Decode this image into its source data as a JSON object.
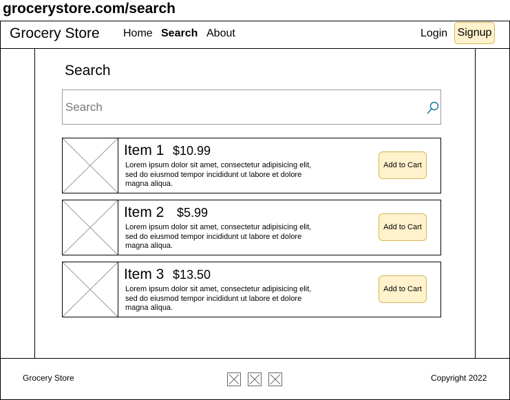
{
  "url_bar": {
    "url": "grocerystore.com/search"
  },
  "header": {
    "brand": "Grocery Store",
    "nav": [
      {
        "label": "Home",
        "active": false
      },
      {
        "label": "Search",
        "active": true
      },
      {
        "label": "About",
        "active": false
      }
    ],
    "login_label": "Login",
    "signup_label": "Signup"
  },
  "search": {
    "title": "Search",
    "placeholder": "Search",
    "value": "",
    "icon": "search-icon"
  },
  "results": [
    {
      "name": "Item 1",
      "price": "$10.99",
      "description": "Lorem ipsum dolor sit amet, consectetur adipisicing elit, sed do eiusmod tempor incididunt ut labore et dolore magna aliqua.",
      "button_label": "Add to Cart"
    },
    {
      "name": "Item 2",
      "price": "$5.99",
      "description": "Lorem ipsum dolor sit amet, consectetur adipisicing elit, sed do eiusmod tempor incididunt ut labore et dolore magna aliqua.",
      "button_label": "Add to Cart"
    },
    {
      "name": "Item 3",
      "price": "$13.50",
      "description": "Lorem ipsum dolor sit amet, consectetur adipisicing elit, sed do eiusmod tempor incididunt ut labore et dolore magna aliqua.",
      "button_label": "Add to Cart"
    }
  ],
  "footer": {
    "brand": "Grocery Store",
    "copyright": "Copyright 2022",
    "social_icons": [
      "image-placeholder-icon",
      "image-placeholder-icon",
      "image-placeholder-icon"
    ]
  },
  "colors": {
    "button_fill": "#fff2cc",
    "button_border": "#d6b656",
    "search_icon": "#10739e",
    "placeholder_stroke": "#999999"
  }
}
